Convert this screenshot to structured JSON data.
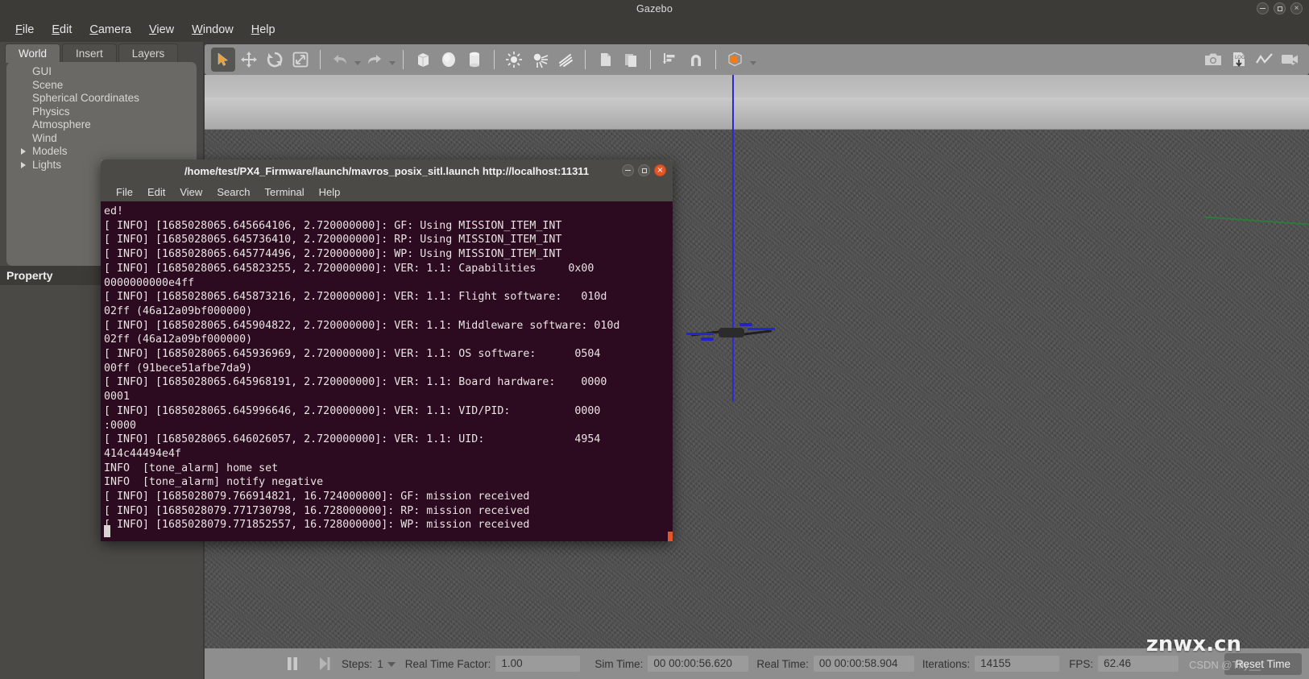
{
  "window": {
    "title": "Gazebo",
    "buttons": [
      {
        "name": "minimize",
        "glyph": "–"
      },
      {
        "name": "maximize",
        "glyph": "□"
      },
      {
        "name": "close",
        "glyph": "×"
      }
    ]
  },
  "menubar": {
    "items": [
      {
        "label": "File",
        "mnemonic": "F",
        "rest": "ile"
      },
      {
        "label": "Edit",
        "mnemonic": "E",
        "rest": "dit"
      },
      {
        "label": "Camera",
        "mnemonic": "C",
        "rest": "amera"
      },
      {
        "label": "View",
        "mnemonic": "V",
        "rest": "iew"
      },
      {
        "label": "Window",
        "mnemonic": "W",
        "rest": "indow"
      },
      {
        "label": "Help",
        "mnemonic": "H",
        "rest": "elp"
      }
    ]
  },
  "left_panel": {
    "tabs": [
      {
        "label": "World",
        "active": true
      },
      {
        "label": "Insert",
        "active": false
      },
      {
        "label": "Layers",
        "active": false
      }
    ],
    "tree": [
      {
        "label": "GUI",
        "expandable": false
      },
      {
        "label": "Scene",
        "expandable": false
      },
      {
        "label": "Spherical Coordinates",
        "expandable": false
      },
      {
        "label": "Physics",
        "expandable": false
      },
      {
        "label": "Atmosphere",
        "expandable": false
      },
      {
        "label": "Wind",
        "expandable": false
      },
      {
        "label": "Models",
        "expandable": true
      },
      {
        "label": "Lights",
        "expandable": true
      }
    ],
    "property_header": "Property"
  },
  "toolbar": {
    "left_icons": [
      {
        "name": "select-tool",
        "selected": true
      },
      {
        "name": "translate-tool",
        "selected": false
      },
      {
        "name": "rotate-tool",
        "selected": false
      },
      {
        "name": "scale-tool",
        "selected": false
      },
      {
        "name": "undo-tool",
        "selected": false
      },
      {
        "name": "redo-tool",
        "selected": false
      },
      {
        "name": "box-tool",
        "selected": false
      },
      {
        "name": "sphere-tool",
        "selected": false
      },
      {
        "name": "cylinder-tool",
        "selected": false
      },
      {
        "name": "point-light-tool",
        "selected": false
      },
      {
        "name": "spot-light-tool",
        "selected": false
      },
      {
        "name": "directional-light-tool",
        "selected": false
      },
      {
        "name": "copy-tool",
        "selected": false
      },
      {
        "name": "paste-tool",
        "selected": false
      },
      {
        "name": "align-tool",
        "selected": false
      },
      {
        "name": "snap-tool",
        "selected": false
      },
      {
        "name": "view-angle-tool",
        "selected": false
      }
    ],
    "right_icons": [
      {
        "name": "screenshot-icon"
      },
      {
        "name": "log-save-icon",
        "label": "LOG"
      },
      {
        "name": "plot-icon"
      },
      {
        "name": "video-record-icon"
      }
    ]
  },
  "statusbar": {
    "pause_icon": "pause-icon",
    "step_icon": "step-forward-icon",
    "steps_label": "Steps:",
    "steps_value": "1",
    "rtf_label": "Real Time Factor:",
    "rtf_value": "1.00",
    "sim_time_label": "Sim Time:",
    "sim_time_value": "00 00:00:56.620",
    "real_time_label": "Real Time:",
    "real_time_value": "00 00:00:58.904",
    "iterations_label": "Iterations:",
    "iterations_value": "14155",
    "fps_label": "FPS:",
    "fps_value": "62.46",
    "reset_button": "Reset Time"
  },
  "terminal": {
    "title": "/home/test/PX4_Firmware/launch/mavros_posix_sitl.launch http://localhost:11311",
    "menu": [
      "File",
      "Edit",
      "View",
      "Search",
      "Terminal",
      "Help"
    ],
    "buttons": [
      {
        "name": "minimize",
        "glyph": "–"
      },
      {
        "name": "maximize",
        "glyph": "□"
      },
      {
        "name": "close",
        "glyph": "×"
      }
    ],
    "lines": [
      "ed!",
      "[ INFO] [1685028065.645664106, 2.720000000]: GF: Using MISSION_ITEM_INT",
      "[ INFO] [1685028065.645736410, 2.720000000]: RP: Using MISSION_ITEM_INT",
      "[ INFO] [1685028065.645774496, 2.720000000]: WP: Using MISSION_ITEM_INT",
      "[ INFO] [1685028065.645823255, 2.720000000]: VER: 1.1: Capabilities     0x00",
      "0000000000e4ff",
      "[ INFO] [1685028065.645873216, 2.720000000]: VER: 1.1: Flight software:   010d",
      "02ff (46a12a09bf000000)",
      "[ INFO] [1685028065.645904822, 2.720000000]: VER: 1.1: Middleware software: 010d",
      "02ff (46a12a09bf000000)",
      "[ INFO] [1685028065.645936969, 2.720000000]: VER: 1.1: OS software:      0504",
      "00ff (91bece51afbe7da9)",
      "[ INFO] [1685028065.645968191, 2.720000000]: VER: 1.1: Board hardware:    0000",
      "0001",
      "[ INFO] [1685028065.645996646, 2.720000000]: VER: 1.1: VID/PID:          0000",
      ":0000",
      "[ INFO] [1685028065.646026057, 2.720000000]: VER: 1.1: UID:              4954",
      "414c44494e4f",
      "INFO  [tone_alarm] home set",
      "INFO  [tone_alarm] notify negative",
      "[ INFO] [1685028079.766914821, 16.724000000]: GF: mission received",
      "[ INFO] [1685028079.771730798, 16.728000000]: RP: mission received",
      "[ INFO] [1685028079.771852557, 16.728000000]: WP: mission received"
    ]
  },
  "viewport": {
    "model_name": "iris-quadrotor-model",
    "axis_name": "z-axis-line"
  },
  "watermark": {
    "primary": "znwx.cn",
    "secondary": "CSDN @Tfly__"
  },
  "colors": {
    "accent_orange": "#e2572a",
    "chrome": "#3c3b37",
    "toolbar": "#8e8e8e",
    "terminal_bg": "#2c0b20",
    "axis_blue": "#2a2ad8"
  }
}
